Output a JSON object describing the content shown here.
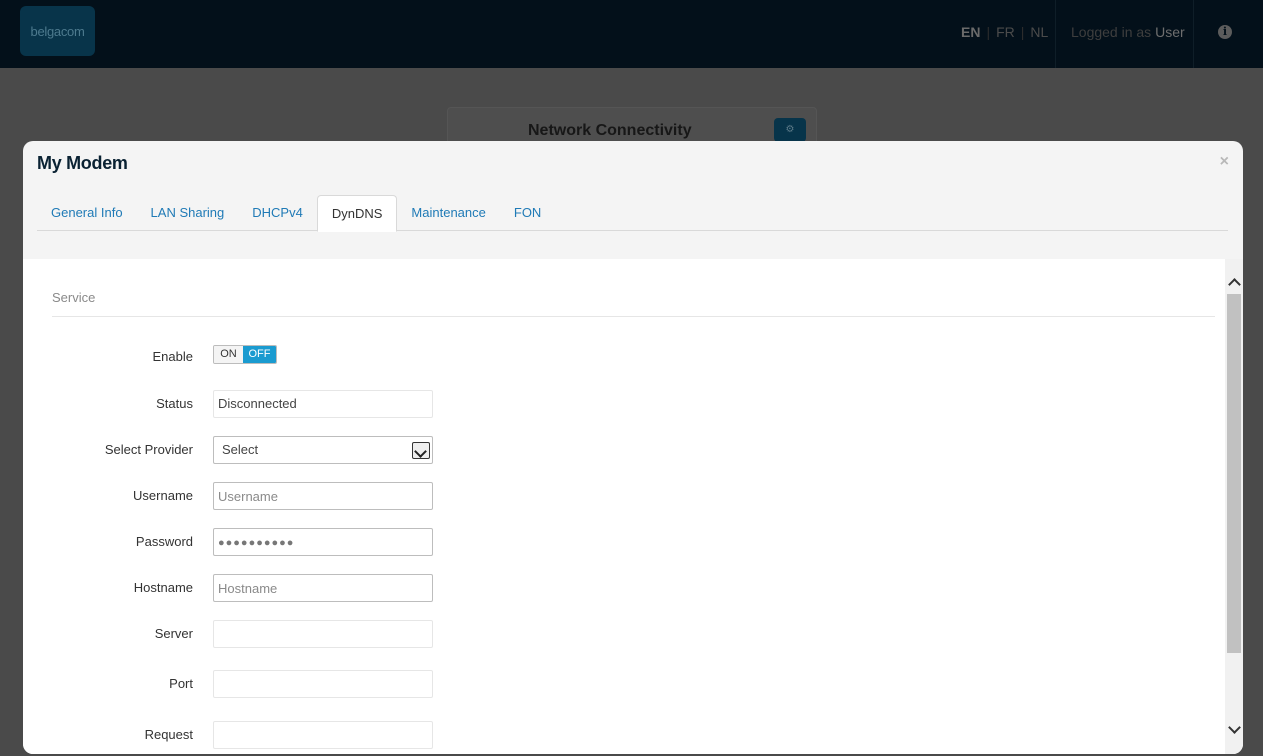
{
  "header": {
    "logo_text": "belgacom",
    "languages": [
      "EN",
      "FR",
      "NL"
    ],
    "logged_in_prefix": "Logged in as",
    "logged_in_user": "User"
  },
  "background_card": {
    "title": "Network Connectivity"
  },
  "modal": {
    "title": "My Modem",
    "close_label": "×",
    "tabs": [
      {
        "label": "General Info"
      },
      {
        "label": "LAN Sharing"
      },
      {
        "label": "DHCPv4"
      },
      {
        "label": "DynDNS"
      },
      {
        "label": "Maintenance"
      },
      {
        "label": "FON"
      }
    ],
    "active_tab": "DynDNS",
    "section_title": "Service",
    "form": {
      "enable": {
        "label": "Enable",
        "on_label": "ON",
        "off_label": "OFF",
        "value": "OFF"
      },
      "status": {
        "label": "Status",
        "value": "Disconnected"
      },
      "provider": {
        "label": "Select Provider",
        "value": "Select"
      },
      "username": {
        "label": "Username",
        "placeholder": "Username",
        "value": ""
      },
      "password": {
        "label": "Password",
        "value": "●●●●●●●●●●"
      },
      "hostname": {
        "label": "Hostname",
        "placeholder": "Hostname",
        "value": ""
      },
      "server": {
        "label": "Server",
        "value": ""
      },
      "port": {
        "label": "Port",
        "value": ""
      },
      "request": {
        "label": "Request",
        "value": ""
      }
    }
  },
  "colors": {
    "accent": "#1a9bd0",
    "link": "#1f7ab6",
    "header_bg": "#03101a",
    "title": "#0a2233"
  }
}
